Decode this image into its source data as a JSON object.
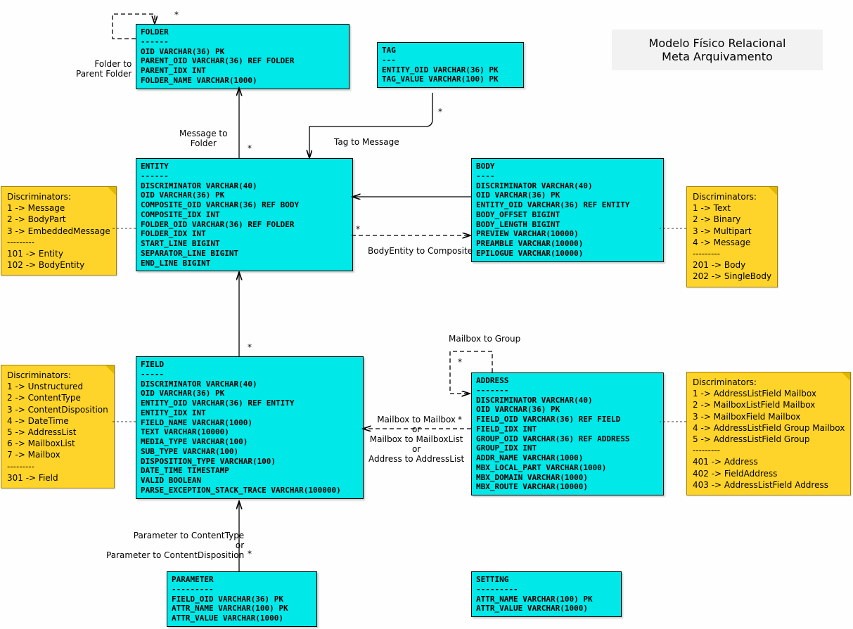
{
  "title": {
    "line1": "Modelo Físico Relacional",
    "line2": "Meta Arquivamento"
  },
  "entities": {
    "folder": {
      "name": "FOLDER",
      "sep": "------",
      "rows": [
        "OID VARCHAR(36) PK",
        "PARENT_OID VARCHAR(36) REF FOLDER",
        "PARENT_IDX INT",
        "FOLDER_NAME VARCHAR(1000)"
      ]
    },
    "tag": {
      "name": "TAG",
      "sep": "---",
      "rows": [
        "ENTITY_OID VARCHAR(36) PK",
        "TAG_VALUE VARCHAR(100) PK"
      ]
    },
    "entity": {
      "name": "ENTITY",
      "sep": "------",
      "rows": [
        "DISCRIMINATOR VARCHAR(40)",
        "OID VARCHAR(36) PK",
        "COMPOSITE_OID VARCHAR(36) REF BODY",
        "COMPOSITE_IDX INT",
        "FOLDER_OID VARCHAR(36) REF FOLDER",
        "FOLDER_IDX INT",
        "START_LINE BIGINT",
        "SEPARATOR_LINE BIGINT",
        "END_LINE BIGINT"
      ]
    },
    "body": {
      "name": "BODY",
      "sep": "----",
      "rows": [
        "DISCRIMINATOR VARCHAR(40)",
        "OID VARCHAR(36) PK",
        "ENTITY_OID VARCHAR(36) REF ENTITY",
        "BODY_OFFSET BIGINT",
        "BODY_LENGTH BIGINT",
        "PREVIEW VARCHAR(10000)",
        "PREAMBLE VARCHAR(10000)",
        "EPILOGUE VARCHAR(10000)"
      ]
    },
    "field": {
      "name": "FIELD",
      "sep": "-----",
      "rows": [
        "DISCRIMINATOR VARCHAR(40)",
        "OID VARCHAR(36) PK",
        "ENTITY_OID VARCHAR(36) REF ENTITY",
        "ENTITY_IDX INT",
        "FIELD_NAME VARCHAR(1000)",
        "TEXT VARCHAR(10000)",
        "MEDIA_TYPE VARCHAR(100)",
        "SUB_TYPE VARCHAR(100)",
        "DISPOSITION_TYPE VARCHAR(100)",
        "DATE_TIME TIMESTAMP",
        "VALID BOOLEAN",
        "PARSE_EXCEPTION_STACK_TRACE VARCHAR(100000)"
      ]
    },
    "address": {
      "name": "ADDRESS",
      "sep": "-------",
      "rows": [
        "DISCRIMINATOR VARCHAR(40)",
        "OID VARCHAR(36) PK",
        "FIELD_OID VARCHAR(36) REF FIELD",
        "FIELD_IDX INT",
        "GROUP_OID VARCHAR(36) REF ADDRESS",
        "GROUP_IDX INT",
        "ADDR_NAME VARCHAR(1000)",
        "MBX_LOCAL_PART VARCHAR(1000)",
        "MBX_DOMAIN VARCHAR(1000)",
        "MBX_ROUTE VARCHAR(10000)"
      ]
    },
    "parameter": {
      "name": "PARAMETER",
      "sep": "---------",
      "rows": [
        "FIELD_OID VARCHAR(36) PK",
        "ATTR_NAME VARCHAR(100) PK",
        "ATTR_VALUE VARCHAR(1000)"
      ]
    },
    "setting": {
      "name": "SETTING",
      "sep": "---------",
      "rows": [
        "ATTR_NAME VARCHAR(100) PK",
        "ATTR_VALUE VARCHAR(1000)"
      ]
    }
  },
  "notes": {
    "entity_disc": "Discriminators:\n1 -> Message\n2 -> BodyPart\n3 -> EmbeddedMessage\n---------\n101 -> Entity\n102 -> BodyEntity",
    "body_disc": "Discriminators:\n1 -> Text\n2 -> Binary\n3 -> Multipart\n4 -> Message\n---------\n201 -> Body\n202 -> SingleBody",
    "field_disc": "Discriminators:\n1 -> Unstructured\n2 -> ContentType\n3 -> ContentDisposition\n4 -> DateTime\n5 -> AddressList\n6 -> MailboxList\n7 -> Mailbox\n---------\n301 -> Field",
    "address_disc": "Discriminators:\n1 -> AddressListField Mailbox\n2 -> MailboxListField Mailbox\n3 -> MailboxField Mailbox\n4 -> AddressListField Group Mailbox\n5 -> AddressListField Group\n---------\n401 -> Address\n402 -> FieldAddress\n403 -> AddressListField Address"
  },
  "labels": {
    "folder_self": "Folder to\nParent Folder",
    "msg_folder": "Message to\nFolder",
    "tag_msg": "Tag to Message",
    "body_comp": "BodyEntity to Composite",
    "mbx_group": "Mailbox to Group",
    "addr_field": "Mailbox to Mailbox\nor\nMailbox to MailboxList\nor\nAddress to AddressList",
    "param_field": "Parameter to ContentType\nor\nParameter to ContentDisposition",
    "star": "*"
  }
}
